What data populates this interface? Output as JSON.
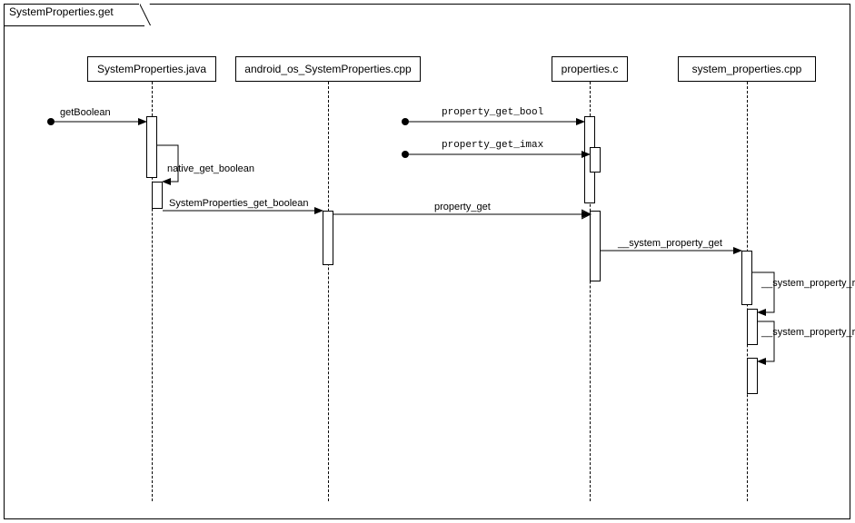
{
  "diagram_title": "SystemProperties.get",
  "participants": {
    "p1": "SystemProperties.java",
    "p2": "android_os_SystemProperties.cpp",
    "p3": "properties.c",
    "p4": "system_properties.cpp"
  },
  "messages": {
    "m1": "getBoolean",
    "m2": "native_get_boolean",
    "m3": "SystemProperties_get_boolean",
    "m4": "property_get_bool",
    "m5": "property_get_imax",
    "m6": "property_get",
    "m7": "__system_property_get",
    "m8": "__system_property_read",
    "m9": "__system_property_read"
  },
  "chart_data": {
    "type": "sequence-diagram",
    "title": "SystemProperties.get",
    "participants": [
      {
        "id": "p1",
        "name": "SystemProperties.java"
      },
      {
        "id": "p2",
        "name": "android_os_SystemProperties.cpp"
      },
      {
        "id": "p3",
        "name": "properties.c"
      },
      {
        "id": "p4",
        "name": "system_properties.cpp"
      }
    ],
    "messages": [
      {
        "from": "found",
        "to": "p1",
        "label": "getBoolean",
        "type": "sync"
      },
      {
        "from": "p1",
        "to": "p1",
        "label": "native_get_boolean",
        "type": "self"
      },
      {
        "from": "p1",
        "to": "p2",
        "label": "SystemProperties_get_boolean",
        "type": "sync"
      },
      {
        "from": "found",
        "to": "p3",
        "label": "property_get_bool",
        "type": "sync"
      },
      {
        "from": "found",
        "to": "p3",
        "label": "property_get_imax",
        "type": "sync"
      },
      {
        "from": "p2",
        "to": "p3",
        "label": "property_get",
        "type": "sync"
      },
      {
        "from": "p3",
        "to": "p4",
        "label": "__system_property_get",
        "type": "sync"
      },
      {
        "from": "p4",
        "to": "p4",
        "label": "__system_property_read",
        "type": "self"
      },
      {
        "from": "p4",
        "to": "p4",
        "label": "__system_property_read",
        "type": "self"
      }
    ]
  }
}
